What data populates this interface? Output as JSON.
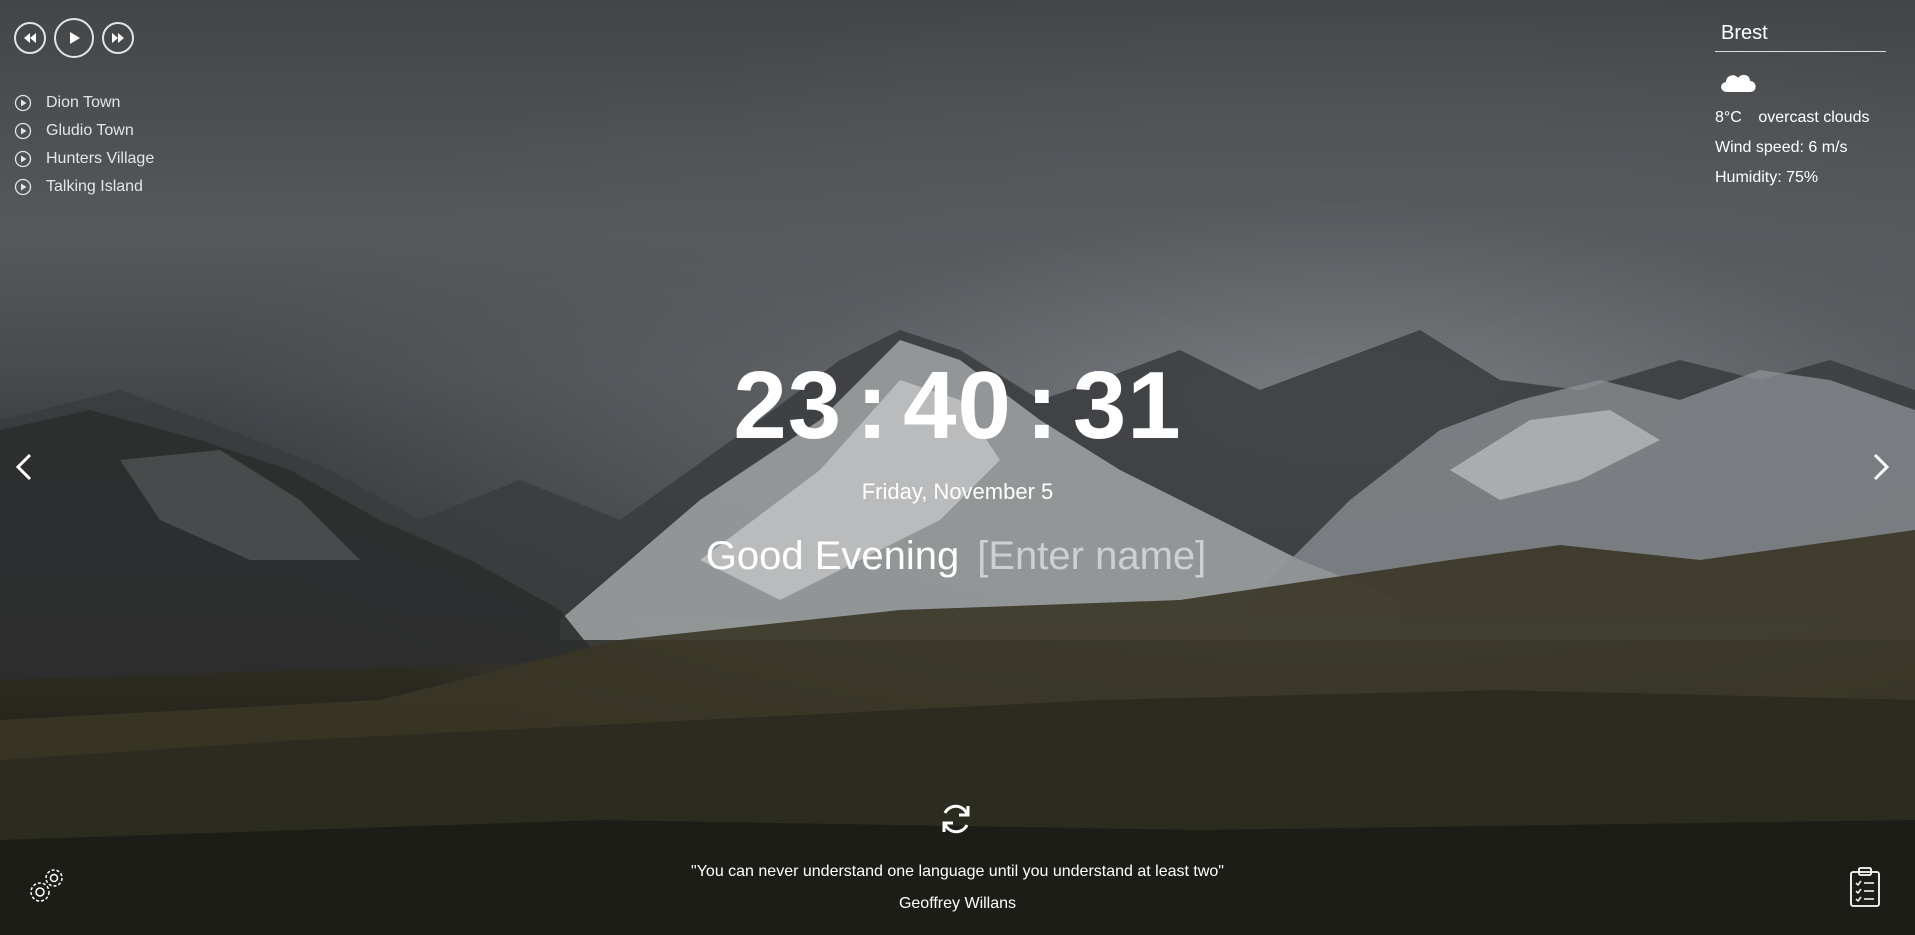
{
  "player": {
    "prev_icon": "rewind-icon",
    "play_icon": "play-icon",
    "next_icon": "fast-forward-icon",
    "playlist": [
      {
        "title": "Dion Town"
      },
      {
        "title": "Gludio Town"
      },
      {
        "title": "Hunters Village"
      },
      {
        "title": "Talking Island"
      }
    ]
  },
  "weather": {
    "city": "Brest",
    "icon": "cloud-icon",
    "temperature": "8°C",
    "description": "overcast clouds",
    "wind": "Wind speed: 6 m/s",
    "humidity": "Humidity: 75%"
  },
  "clock": {
    "hours": "23",
    "minutes": "40",
    "seconds": "31",
    "separator": ":"
  },
  "date": "Friday, November 5",
  "greeting": {
    "text": "Good Evening",
    "name_placeholder": "[Enter name]",
    "name_value": ""
  },
  "quote": {
    "text": "\"You can never understand one language until you understand at least two\"",
    "author": "Geoffrey Willans",
    "refresh_icon": "refresh-icon"
  },
  "controls": {
    "prev_slide_icon": "chevron-left-icon",
    "next_slide_icon": "chevron-right-icon",
    "settings_icon": "gears-icon",
    "todo_icon": "clipboard-checklist-icon"
  },
  "colors": {
    "text": "#ffffff",
    "placeholder": "#9a9a9a"
  }
}
